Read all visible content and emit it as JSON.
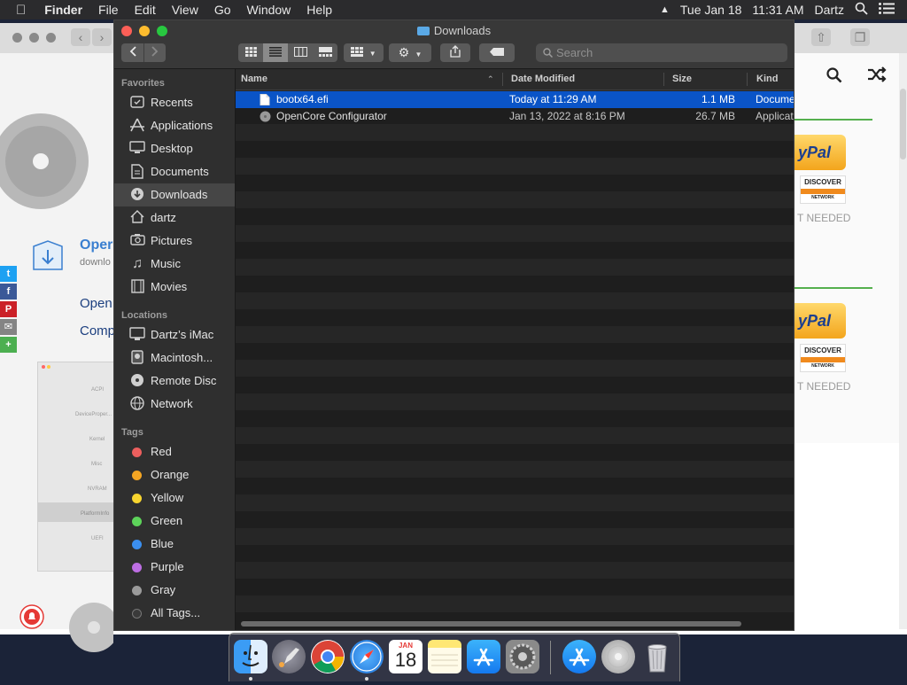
{
  "menubar": {
    "apple": "",
    "items": [
      "Finder",
      "File",
      "Edit",
      "View",
      "Go",
      "Window",
      "Help"
    ],
    "date": "Tue Jan 18",
    "time": "11:31 AM",
    "user": "Dartz"
  },
  "background": {
    "site_link_1": "Oper",
    "site_sub_1": "downlo",
    "site_text_1": "Open",
    "site_text_2": "Comp",
    "paypal": "yPal",
    "discover": "DISCOVER",
    "discover_sub": "NETWORK",
    "not_needed": "T NEEDED",
    "social": [
      "t",
      "f",
      "P",
      "✉",
      "+"
    ],
    "thumb_labels": [
      "ACPI",
      "DeviceProper...",
      "Kernel",
      "Misc",
      "NVRAM",
      "PlatformInfo",
      "UEFI"
    ]
  },
  "window": {
    "title": "Downloads",
    "search_placeholder": "Search"
  },
  "sidebar": {
    "favorites_header": "Favorites",
    "favorites": [
      {
        "label": "Recents",
        "icon": "clock-icon"
      },
      {
        "label": "Applications",
        "icon": "applications-icon"
      },
      {
        "label": "Desktop",
        "icon": "desktop-icon"
      },
      {
        "label": "Documents",
        "icon": "documents-icon"
      },
      {
        "label": "Downloads",
        "icon": "downloads-icon",
        "selected": true
      },
      {
        "label": "dartz",
        "icon": "home-icon"
      },
      {
        "label": "Pictures",
        "icon": "camera-icon"
      },
      {
        "label": "Music",
        "icon": "music-note-icon"
      },
      {
        "label": "Movies",
        "icon": "film-icon"
      }
    ],
    "locations_header": "Locations",
    "locations": [
      {
        "label": "Dartz’s iMac",
        "icon": "imac-icon"
      },
      {
        "label": "Macintosh...",
        "icon": "hard-drive-icon"
      },
      {
        "label": "Remote Disc",
        "icon": "disc-icon"
      },
      {
        "label": "Network",
        "icon": "globe-icon"
      }
    ],
    "tags_header": "Tags",
    "tags": [
      {
        "label": "Red",
        "color": "#ec5f5e"
      },
      {
        "label": "Orange",
        "color": "#f5a623"
      },
      {
        "label": "Yellow",
        "color": "#f8d52f"
      },
      {
        "label": "Green",
        "color": "#5dd35a"
      },
      {
        "label": "Blue",
        "color": "#3b8ff0"
      },
      {
        "label": "Purple",
        "color": "#bd6ee3"
      },
      {
        "label": "Gray",
        "color": "#9b9b9b"
      },
      {
        "label": "All Tags...",
        "color": "#3a3a3a"
      }
    ]
  },
  "columns": {
    "name": "Name",
    "date": "Date Modified",
    "size": "Size",
    "kind": "Kind"
  },
  "files": [
    {
      "name": "bootx64.efi",
      "date": "Today at 11:29 AM",
      "size": "1.1 MB",
      "kind": "Docume",
      "selected": true
    },
    {
      "name": "OpenCore Configurator",
      "date": "Jan 13, 2022 at 8:16 PM",
      "size": "26.7 MB",
      "kind": "Applicat",
      "selected": false
    }
  ],
  "dock": {
    "items": [
      "finder-icon",
      "launchpad-icon",
      "chrome-icon",
      "safari-icon",
      "calendar-icon",
      "notes-icon",
      "app-store-icon",
      "system-preferences-icon",
      "app-store-downloads-icon",
      "disk-utility-icon",
      "trash-icon"
    ],
    "calendar_month": "JAN",
    "calendar_day": "18"
  }
}
